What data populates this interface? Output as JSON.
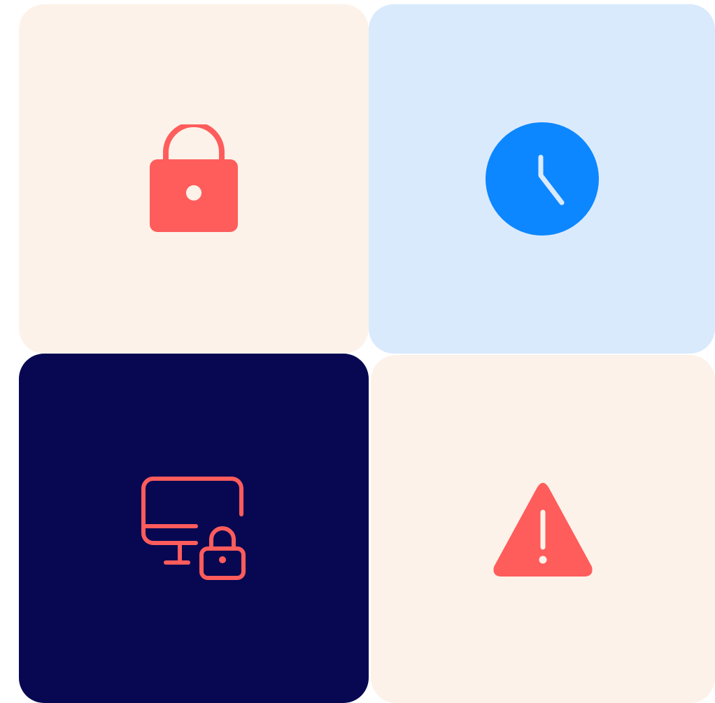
{
  "tiles": [
    {
      "icon": "lock-icon",
      "background": "#FDF2E9",
      "icon_color": "#FF5C5C"
    },
    {
      "icon": "clock-icon",
      "background": "#DAEAFD",
      "icon_color": "#0C87FF"
    },
    {
      "icon": "monitor-lock-icon",
      "background": "#080852",
      "icon_color": "#FF5C5C"
    },
    {
      "icon": "warning-triangle-icon",
      "background": "#FDF2E9",
      "icon_color": "#FF5C5C"
    }
  ]
}
